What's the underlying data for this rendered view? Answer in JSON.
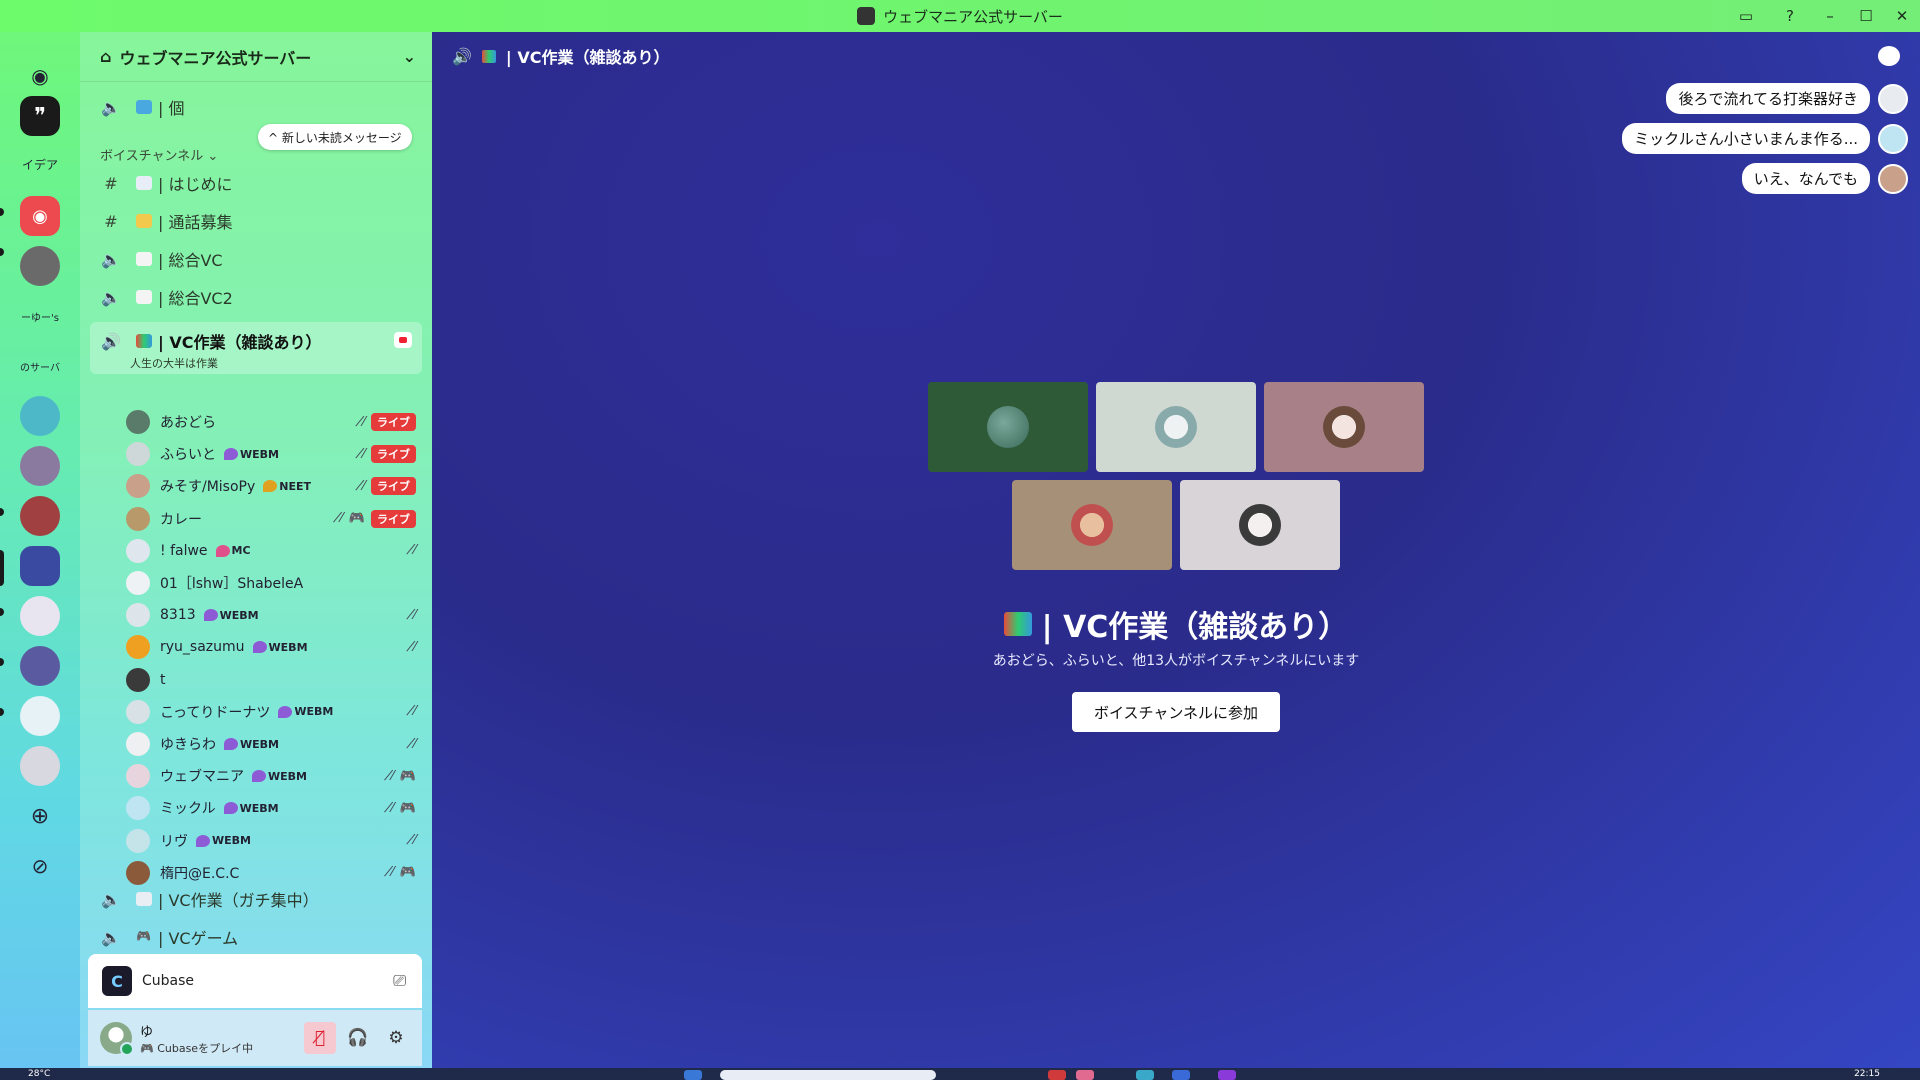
{
  "window": {
    "title": "ウェブマニア公式サーバー"
  },
  "rail": {
    "ideas_label": "イデア",
    "small_label_1": "ーゆー's",
    "small_label_2": "のサーバ"
  },
  "server": {
    "name": "ウェブマニア公式サーバー"
  },
  "new_messages_label": "^ 新しい未読メッセージ",
  "category": "ボイスチャンネル ⌄",
  "channels": [
    {
      "name": "| 個",
      "icon": "speaker"
    },
    {
      "name": "| はじめに",
      "icon": "hash"
    },
    {
      "name": "| 通話募集",
      "icon": "hash"
    },
    {
      "name": "| 総合VC",
      "icon": "speaker"
    },
    {
      "name": "| 総合VC2",
      "icon": "speaker"
    }
  ],
  "active_channel": {
    "name": "| VC作業（雑談あり）",
    "subtitle": "人生の大半は作業"
  },
  "voice_users": [
    {
      "name": "あおどら",
      "tag": "",
      "live": "ライブ",
      "avatar": "#5a7a6a"
    },
    {
      "name": "ふらいと",
      "tag": "WEBM",
      "live": "ライブ",
      "avatar": "#cfd8d8"
    },
    {
      "name": "みそす/MisoPy",
      "tag": "NEET",
      "live": "ライブ",
      "avatar": "#c9a08a"
    },
    {
      "name": "カレー",
      "tag": "",
      "live": "ライブ",
      "avatar": "#b89a6a"
    },
    {
      "name": "! falwe",
      "tag": "MC",
      "live": "",
      "avatar": "#e0e6ee"
    },
    {
      "name": "01［lshw］ShabeleA",
      "tag": "",
      "live": "",
      "avatar": "#eef2f4"
    },
    {
      "name": "8313",
      "tag": "WEBM",
      "live": "",
      "avatar": "#dde4ea"
    },
    {
      "name": "ryu_sazumu",
      "tag": "WEBM",
      "live": "",
      "avatar": "#f0a020"
    },
    {
      "name": "t",
      "tag": "",
      "live": "",
      "avatar": "#3a3a3a"
    },
    {
      "name": "こってりドーナツ",
      "tag": "WEBM",
      "live": "",
      "avatar": "#d8e2e6"
    },
    {
      "name": "ゆきらわ",
      "tag": "WEBM",
      "live": "",
      "avatar": "#eef0f2"
    },
    {
      "name": "ウェブマニア",
      "tag": "WEBM",
      "live": "",
      "avatar": "#e8d4dc"
    },
    {
      "name": "ミックル",
      "tag": "WEBM",
      "live": "",
      "avatar": "#bfe4f2"
    },
    {
      "name": "リヴ",
      "tag": "WEBM",
      "live": "",
      "avatar": "#c4e4ea"
    },
    {
      "name": "楕円@E.C.C",
      "tag": "",
      "live": "",
      "avatar": "#8a5a3a"
    }
  ],
  "channels_after": [
    {
      "name": "| VC作業（ガチ集中）",
      "icon": "speaker"
    },
    {
      "name": "| VCゲーム",
      "icon": "speaker"
    }
  ],
  "activity": {
    "app": "Cubase"
  },
  "user": {
    "name": "ゆ",
    "status": "Cubaseをプレイ中"
  },
  "main": {
    "header_title": "| VC作業（雑談あり）",
    "bubbles": [
      "後ろで流れてる打楽器好き",
      "ミックルさん小さいまんま作る...",
      "いえ、なんでも"
    ],
    "vc_title": "| VC作業（雑談あり）",
    "vc_subtitle": "あおどら、ふらいと、他13人がボイスチャンネルにいます",
    "join_label": "ボイスチャンネルに参加"
  },
  "taskbar": {
    "weather": "28°C",
    "clock": "22:15"
  },
  "colors": {
    "live": "#e63b3b",
    "webm_tag": "#8e5bd6",
    "titlebar": "#6dfa6b"
  }
}
